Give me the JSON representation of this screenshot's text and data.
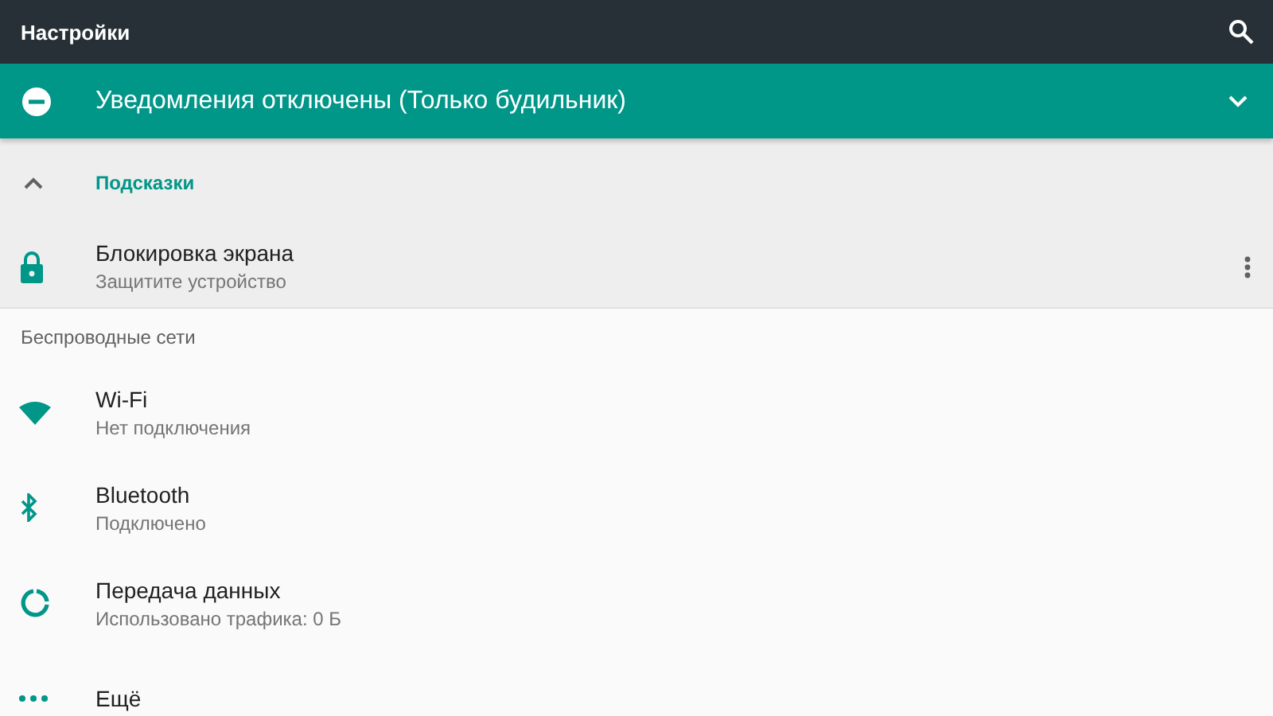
{
  "toolbar": {
    "title": "Настройки"
  },
  "banner": {
    "text": "Уведомления отключены (Только будильник)",
    "expanded": false
  },
  "suggestions": {
    "title": "Подсказки",
    "expanded": true,
    "items": [
      {
        "title": "Блокировка экрана",
        "subtitle": "Защитите устройство"
      }
    ]
  },
  "section": {
    "title": "Беспроводные сети",
    "items": [
      {
        "kind": "wifi",
        "title": "Wi-Fi",
        "subtitle": "Нет подключения"
      },
      {
        "kind": "bluetooth",
        "title": "Bluetooth",
        "subtitle": "Подключено"
      },
      {
        "kind": "data",
        "title": "Передача данных",
        "subtitle": "Использовано трафика: 0 Б"
      },
      {
        "kind": "more",
        "title": "Ещё"
      }
    ]
  }
}
